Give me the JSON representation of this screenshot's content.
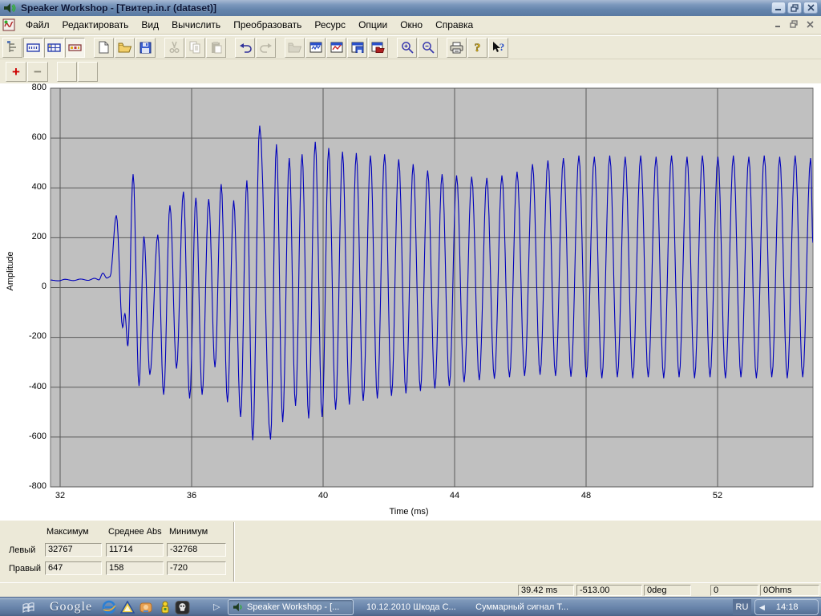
{
  "window": {
    "title": "Speaker Workshop - [Твитер.in.r (dataset)]",
    "controls": {
      "minimize": "–",
      "restore": "❐",
      "close": "✕"
    }
  },
  "menu": {
    "items": [
      "Файл",
      "Редактировать",
      "Вид",
      "Вычислить",
      "Преобразовать",
      "Ресурс",
      "Опции",
      "Окно",
      "Справка"
    ]
  },
  "toolbar": {
    "icons": [
      "tree-view",
      "notebook-bar",
      "notebook-grid",
      "value-bar",
      "new-document",
      "open-folder",
      "save",
      "cut",
      "copy",
      "paste",
      "undo",
      "redo",
      "import-chart",
      "chart-window",
      "chart-line",
      "chart-save",
      "chart-folder",
      "zoom-in",
      "zoom-out",
      "print",
      "help",
      "context-help"
    ],
    "zoom_plus_label": "+",
    "zoom_minus_label": "−"
  },
  "chart_data": {
    "type": "line",
    "xlabel": "Time (ms)",
    "ylabel": "Amplitude",
    "xlim": [
      31.71,
      54.9
    ],
    "ylim": [
      -800,
      800
    ],
    "x_ticks": [
      32,
      36,
      40,
      44,
      48,
      52
    ],
    "y_ticks": [
      800,
      600,
      400,
      200,
      0,
      -200,
      -400,
      -600,
      -800
    ],
    "grid": true,
    "plot_bg": "#c0c0c0",
    "grid_color": "#5a5a5a",
    "series": [
      {
        "name": "Правый",
        "color": "#0000bb",
        "points": [
          [
            31.71,
            30
          ],
          [
            31.95,
            27
          ],
          [
            32.15,
            33
          ],
          [
            32.4,
            28
          ],
          [
            32.62,
            34
          ],
          [
            32.85,
            29
          ],
          [
            33.05,
            37
          ],
          [
            33.18,
            31
          ],
          [
            33.3,
            58
          ],
          [
            33.42,
            38
          ],
          [
            33.52,
            44
          ],
          [
            33.71,
            290
          ],
          [
            33.9,
            -160
          ],
          [
            33.97,
            -105
          ],
          [
            34.06,
            -235
          ],
          [
            34.22,
            455
          ],
          [
            34.4,
            -395
          ],
          [
            34.55,
            205
          ],
          [
            34.73,
            -350
          ],
          [
            34.97,
            212
          ],
          [
            35.15,
            -430
          ],
          [
            35.34,
            330
          ],
          [
            35.54,
            -325
          ],
          [
            35.75,
            385
          ],
          [
            35.94,
            -445
          ],
          [
            36.13,
            360
          ],
          [
            36.32,
            -430
          ],
          [
            36.52,
            355
          ],
          [
            36.71,
            -320
          ],
          [
            36.9,
            415
          ],
          [
            37.09,
            -460
          ],
          [
            37.28,
            350
          ],
          [
            37.49,
            -520
          ],
          [
            37.68,
            430
          ],
          [
            37.86,
            -613
          ],
          [
            38.07,
            650
          ],
          [
            38.4,
            -610
          ],
          [
            38.58,
            575
          ],
          [
            38.77,
            -540
          ],
          [
            38.97,
            520
          ],
          [
            39.16,
            -475
          ],
          [
            39.36,
            535
          ],
          [
            39.56,
            -525
          ],
          [
            39.76,
            585
          ],
          [
            39.97,
            -520
          ],
          [
            40.17,
            560
          ],
          [
            40.38,
            -490
          ],
          [
            40.59,
            545
          ],
          [
            40.8,
            -470
          ],
          [
            41.01,
            540
          ],
          [
            41.22,
            -455
          ],
          [
            41.44,
            530
          ],
          [
            41.65,
            -445
          ],
          [
            41.87,
            535
          ],
          [
            42.08,
            -435
          ],
          [
            42.3,
            515
          ],
          [
            42.52,
            -425
          ],
          [
            42.74,
            495
          ],
          [
            42.96,
            -415
          ],
          [
            43.18,
            470
          ],
          [
            43.4,
            -405
          ],
          [
            43.62,
            455
          ],
          [
            43.84,
            -395
          ],
          [
            44.06,
            450
          ],
          [
            44.29,
            -380
          ],
          [
            44.52,
            445
          ],
          [
            44.75,
            -372
          ],
          [
            44.98,
            440
          ],
          [
            45.21,
            -366
          ],
          [
            45.44,
            450
          ],
          [
            45.67,
            -360
          ],
          [
            45.9,
            465
          ],
          [
            46.13,
            -355
          ],
          [
            46.37,
            495
          ],
          [
            46.6,
            -350
          ],
          [
            46.84,
            510
          ],
          [
            47.07,
            -355
          ],
          [
            47.31,
            520
          ],
          [
            47.54,
            -358
          ],
          [
            47.78,
            530
          ],
          [
            48.01,
            -360
          ],
          [
            48.25,
            525
          ],
          [
            48.48,
            -364
          ],
          [
            48.72,
            530
          ],
          [
            48.95,
            -360
          ],
          [
            49.19,
            525
          ],
          [
            49.42,
            -364
          ],
          [
            49.66,
            530
          ],
          [
            49.89,
            -360
          ],
          [
            50.13,
            525
          ],
          [
            50.36,
            -364
          ],
          [
            50.6,
            530
          ],
          [
            50.83,
            -360
          ],
          [
            51.07,
            525
          ],
          [
            51.3,
            -364
          ],
          [
            51.54,
            530
          ],
          [
            51.77,
            -360
          ],
          [
            52.01,
            525
          ],
          [
            52.24,
            -364
          ],
          [
            52.48,
            530
          ],
          [
            52.71,
            -360
          ],
          [
            52.95,
            525
          ],
          [
            53.18,
            -364
          ],
          [
            53.42,
            530
          ],
          [
            53.65,
            -360
          ],
          [
            53.89,
            525
          ],
          [
            54.12,
            -364
          ],
          [
            54.36,
            530
          ],
          [
            54.59,
            -360
          ],
          [
            54.83,
            520
          ],
          [
            54.9,
            180
          ]
        ]
      }
    ]
  },
  "stats": {
    "headers": [
      "Максимум",
      "Среднее Abs",
      "Минимум"
    ],
    "rows": [
      {
        "label": "Левый",
        "values": [
          "32767",
          "11714",
          "-32768"
        ]
      },
      {
        "label": "Правый",
        "values": [
          "647",
          "158",
          "-720"
        ]
      }
    ]
  },
  "status": {
    "fields": [
      "39.42  ms",
      "-513.00",
      "0deg",
      "0",
      "0Ohms"
    ]
  },
  "taskbar": {
    "google_label": "Google",
    "quick_launch_icons": [
      "windows-flag",
      "internet-explorer",
      "delphi-triangle",
      "orange-app",
      "qip-yellow",
      "skull-app"
    ],
    "more_chevron": "▷",
    "tasks": [
      {
        "label": "Speaker Workshop - [...",
        "active": true
      },
      {
        "label": "10.12.2010 Шкода С...",
        "active": false
      },
      {
        "label": "Суммарный сигнал Т...",
        "active": false
      }
    ],
    "language": "RU",
    "hide_arrow": "◀",
    "time": "14:18"
  }
}
